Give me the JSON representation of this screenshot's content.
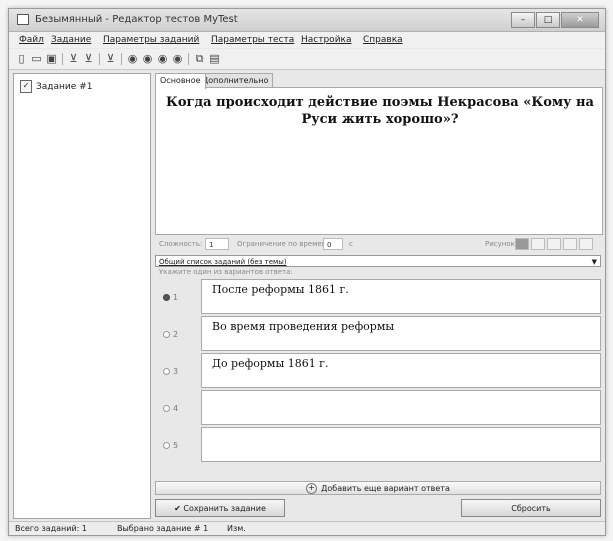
{
  "window": {
    "title": "Безымянный - Редактор тестов MyTest",
    "controls": {
      "minimize": "–",
      "maximize": "□",
      "close": "✕"
    }
  },
  "menu": [
    "Файл",
    "Задание",
    "Параметры заданий",
    "Параметры теста",
    "Настройка",
    "Справка"
  ],
  "toolbar_icons": [
    "new-icon",
    "open-icon",
    "save-icon",
    "filter-icon",
    "filter-add-icon",
    "filter-remove-icon",
    "circle-icon-1",
    "circle-icon-2",
    "circle-icon-3",
    "circle-icon-4",
    "copy-icon",
    "paste-icon"
  ],
  "tree": {
    "item": "Задание #1"
  },
  "tabs": [
    "Основное",
    "Дополнительно"
  ],
  "question": "Когда происходит действие поэмы Некрасова «Кому на Руси жить хорошо»?",
  "options_row": {
    "complexity_label": "Сложность:",
    "complexity_value": "1",
    "time_label": "Ограничение по времени:",
    "time_value": "0",
    "time_unit": "с",
    "picture_label": "Рисунок:"
  },
  "task_type": "Общий список заданий (без темы)",
  "hint": "Укажите один из вариантов ответа:",
  "answers": [
    {
      "num": "1",
      "text": "После реформы 1861 г.",
      "selected": true
    },
    {
      "num": "2",
      "text": "Во время проведения реформы",
      "selected": false
    },
    {
      "num": "3",
      "text": "До реформы 1861 г.",
      "selected": false
    },
    {
      "num": "4",
      "text": "",
      "selected": false
    },
    {
      "num": "5",
      "text": "",
      "selected": false
    }
  ],
  "add_answer_label": "Добавить еще вариант ответа",
  "save_label": "Сохранить задание",
  "reset_label": "Сбросить",
  "status": {
    "total": "Всего заданий: 1",
    "selected": "Выбрано задание # 1",
    "changed": "Изм."
  }
}
